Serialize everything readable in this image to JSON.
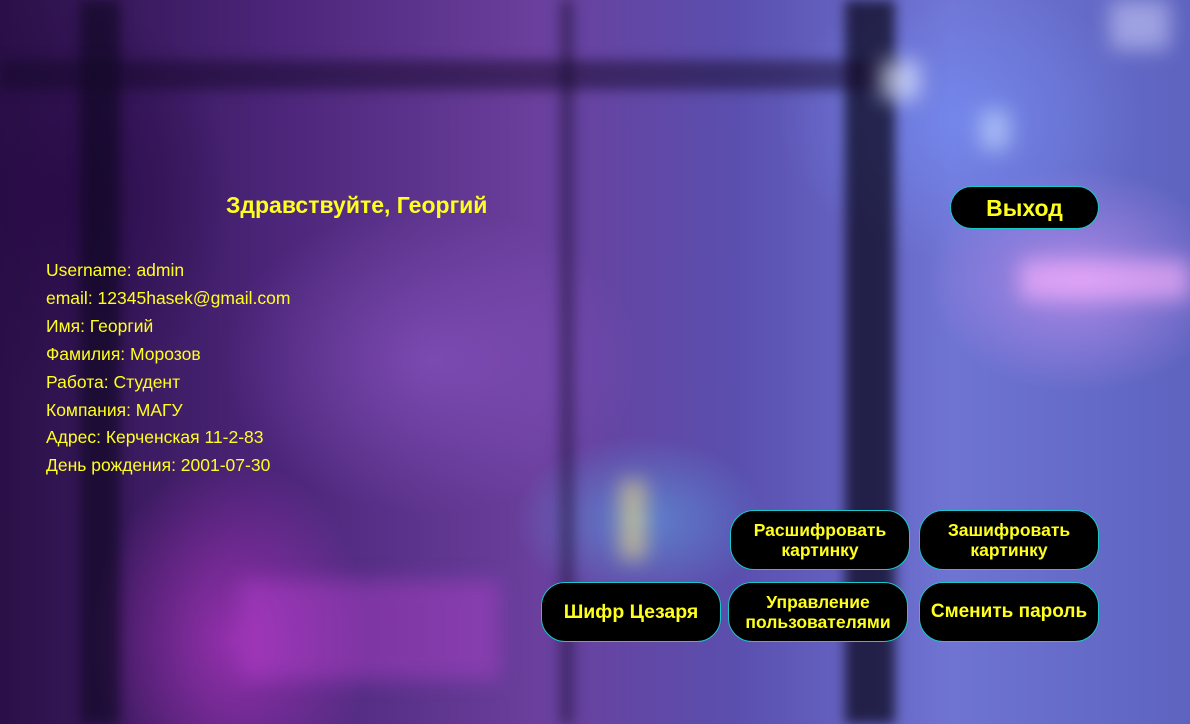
{
  "header": {
    "greeting": "Здравствуйте, Георгий",
    "logout_label": "Выход"
  },
  "profile": {
    "lines": [
      "Username: admin",
      "email: 12345hasek@gmail.com",
      "Имя: Георгий",
      "Фамилия: Морозов",
      "Работа: Студент",
      "Компания: МАГУ",
      "Адрес: Керченская 11-2-83",
      "День рождения: 2001-07-30"
    ]
  },
  "actions": {
    "decrypt_image": "Расшифровать картинку",
    "encrypt_image": "Зашифровать картинку",
    "caesar_cipher": "Шифр Цезаря",
    "manage_users": "Управление пользователями",
    "change_password": "Сменить пароль"
  },
  "colors": {
    "text_accent": "#ffff1e",
    "button_bg": "#000000",
    "button_border": "#19c9c9"
  }
}
